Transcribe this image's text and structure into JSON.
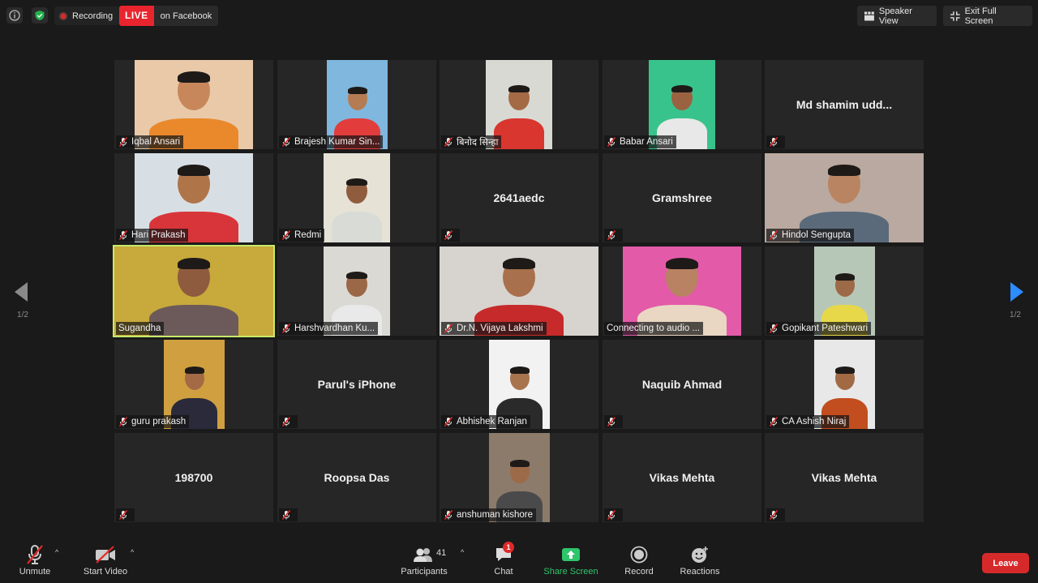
{
  "topbar": {
    "recording_label": "Recording",
    "live_badge": "LIVE",
    "live_target": "on Facebook",
    "speaker_view_label": "Speaker View",
    "exit_fullscreen_label": "Exit Full Screen"
  },
  "nav": {
    "page_left": "1/2",
    "page_right": "1/2"
  },
  "participants": [
    {
      "name": "Iqbal Ansari",
      "video": true,
      "muted": true,
      "skin": "#c7875a",
      "bg": "#e9c9a8",
      "shirt": "#e9892c"
    },
    {
      "name": "Brajesh Kumar Sin...",
      "video": true,
      "muted": true,
      "skin": "#b57b52",
      "bg": "#7fb7de",
      "shirt": "#e23c3c"
    },
    {
      "name": "बिनोद सिन्हा",
      "video": true,
      "muted": true,
      "skin": "#a46a45",
      "bg": "#d9d9d4",
      "shirt": "#d8362f"
    },
    {
      "name": "Babar Ansari",
      "video": true,
      "muted": true,
      "skin": "#9a6241",
      "bg": "#39c38c",
      "shirt": "#e8e8e8"
    },
    {
      "name": "Md shamim udd...",
      "video": false,
      "muted": true
    },
    {
      "name": "Hari Prakash",
      "video": true,
      "muted": true,
      "skin": "#b07449",
      "bg": "#d8dfe4",
      "shirt": "#d8353a"
    },
    {
      "name": "Redmi",
      "video": true,
      "muted": true,
      "skin": "#8f5d3e",
      "bg": "#e6e2d6",
      "shirt": "#d9dcd6"
    },
    {
      "name": "2641aedc",
      "video": false,
      "muted": true
    },
    {
      "name": "Gramshree",
      "video": false,
      "muted": true
    },
    {
      "name": "Hindol Sengupta",
      "video": true,
      "muted": true,
      "skin": "#b98461",
      "bg": "#b9a9a0",
      "shirt": "#5a6a7a"
    },
    {
      "name": "Sugandha",
      "video": true,
      "muted": false,
      "active": true,
      "skin": "#8e5b3f",
      "bg": "#c8a93c",
      "shirt": "#6c5a5a"
    },
    {
      "name": "Harshvardhan Ku...",
      "video": true,
      "muted": true,
      "skin": "#9a6847",
      "bg": "#dad9d4",
      "shirt": "#e9e9e9"
    },
    {
      "name": "Dr.N. Vijaya Lakshmi",
      "video": true,
      "muted": true,
      "skin": "#a8704c",
      "bg": "#d7d3cf",
      "shirt": "#c72a2a"
    },
    {
      "name": "Connecting to audio ...",
      "video": true,
      "muted": false,
      "skin": "#b88263",
      "bg": "#e35aa8",
      "shirt": "#e9d7c3"
    },
    {
      "name": "Gopikant Pateshwari",
      "video": true,
      "muted": true,
      "skin": "#9c6a47",
      "bg": "#b7c7b7",
      "shirt": "#e7d84a"
    },
    {
      "name": "guru prakash",
      "video": true,
      "muted": true,
      "skin": "#a46a45",
      "bg": "#d0a040",
      "shirt": "#2a2a3a"
    },
    {
      "name": "Parul's iPhone",
      "video": false,
      "muted": true
    },
    {
      "name": "Abhishek Ranjan",
      "video": true,
      "muted": true,
      "skin": "#a8744e",
      "bg": "#f2f2f2",
      "shirt": "#2a2a2a"
    },
    {
      "name": "Naquib Ahmad",
      "video": false,
      "muted": true
    },
    {
      "name": "CA Ashish Niraj",
      "video": true,
      "muted": true,
      "skin": "#a16a45",
      "bg": "#e8e8e8",
      "shirt": "#c24d1f"
    },
    {
      "name": "198700",
      "video": false,
      "muted": true
    },
    {
      "name": "Roopsa Das",
      "video": false,
      "muted": true
    },
    {
      "name": "anshuman kishore",
      "video": true,
      "muted": true,
      "skin": "#9d6a48",
      "bg": "#8c7a6a",
      "shirt": "#4a4a4a"
    },
    {
      "name": "Vikas Mehta",
      "video": false,
      "muted": true
    },
    {
      "name": "Vikas Mehta",
      "video": false,
      "muted": true
    }
  ],
  "toolbar": {
    "unmute_label": "Unmute",
    "start_video_label": "Start Video",
    "participants_label": "Participants",
    "participants_count": "41",
    "chat_label": "Chat",
    "chat_badge": "1",
    "share_screen_label": "Share Screen",
    "record_label": "Record",
    "reactions_label": "Reactions",
    "leave_label": "Leave"
  },
  "colors": {
    "live_red": "#e8252e",
    "active_speaker": "#c7e96a",
    "share_green": "#2fc56b",
    "leave_red": "#d62a2a"
  }
}
